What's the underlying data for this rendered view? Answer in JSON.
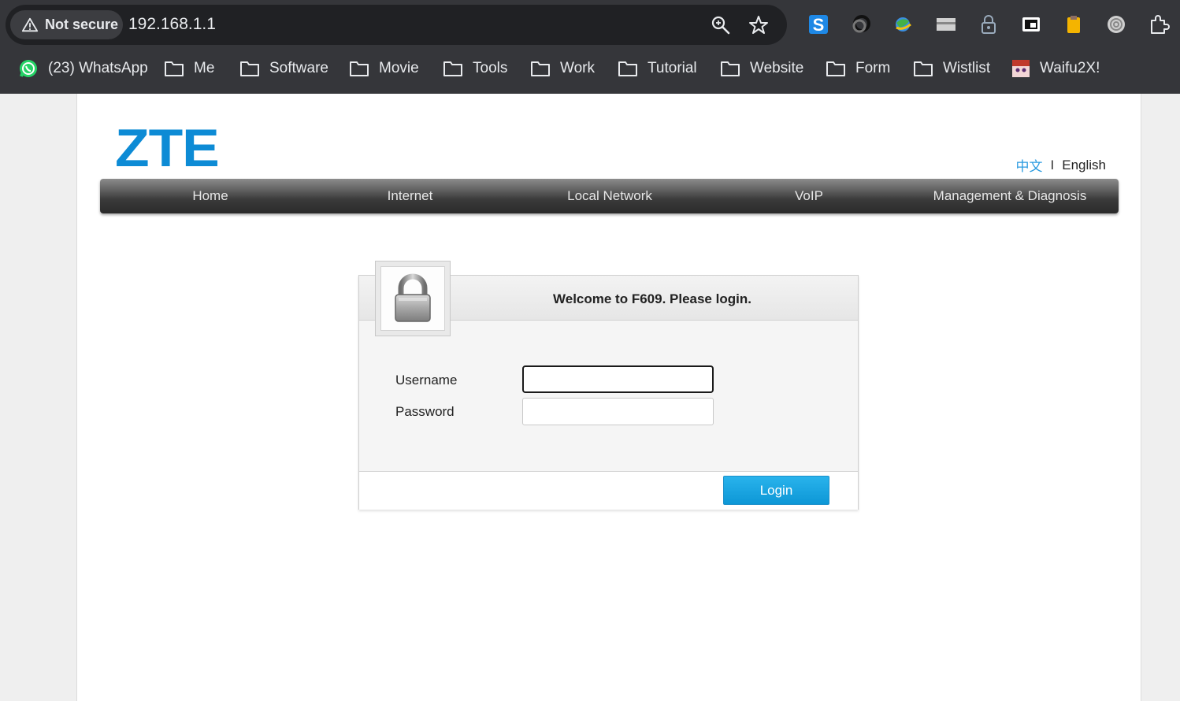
{
  "browser": {
    "security_label": "Not secure",
    "url": "192.168.1.1",
    "icons": [
      "zoom-icon",
      "bookmark-star-icon"
    ],
    "extensions": [
      "extension-s-icon",
      "extension-link-icon",
      "extension-globe-icon",
      "extension-card-icon",
      "extension-lock-icon",
      "extension-pip-icon",
      "extension-clipboard-icon",
      "extension-spiral-icon",
      "extensions-puzzle-icon"
    ],
    "bookmarks": [
      {
        "label": "(23) WhatsApp",
        "icon": "whatsapp-icon"
      },
      {
        "label": "Me",
        "icon": "folder-icon"
      },
      {
        "label": "Software",
        "icon": "folder-icon"
      },
      {
        "label": "Movie",
        "icon": "folder-icon"
      },
      {
        "label": "Tools",
        "icon": "folder-icon"
      },
      {
        "label": "Work",
        "icon": "folder-icon"
      },
      {
        "label": "Tutorial",
        "icon": "folder-icon"
      },
      {
        "label": "Website",
        "icon": "folder-icon"
      },
      {
        "label": "Form",
        "icon": "folder-icon"
      },
      {
        "label": "Wistlist",
        "icon": "folder-icon"
      },
      {
        "label": "Waifu2X!",
        "icon": "waifu-icon"
      }
    ]
  },
  "header": {
    "logo": "ZTE",
    "lang_zh": "中文",
    "lang_separator": "I",
    "lang_en": "English"
  },
  "nav": {
    "items": [
      "Home",
      "Internet",
      "Local Network",
      "VoIP",
      "Management & Diagnosis"
    ]
  },
  "login": {
    "title": "Welcome to F609. Please login.",
    "username_label": "Username",
    "password_label": "Password",
    "username_value": "",
    "password_value": "",
    "button_label": "Login",
    "icon": "lock-icon"
  },
  "colors": {
    "brand": "#0d8bd5",
    "button": "#1aa6e4",
    "nav_dark": "#2a2a2a"
  }
}
